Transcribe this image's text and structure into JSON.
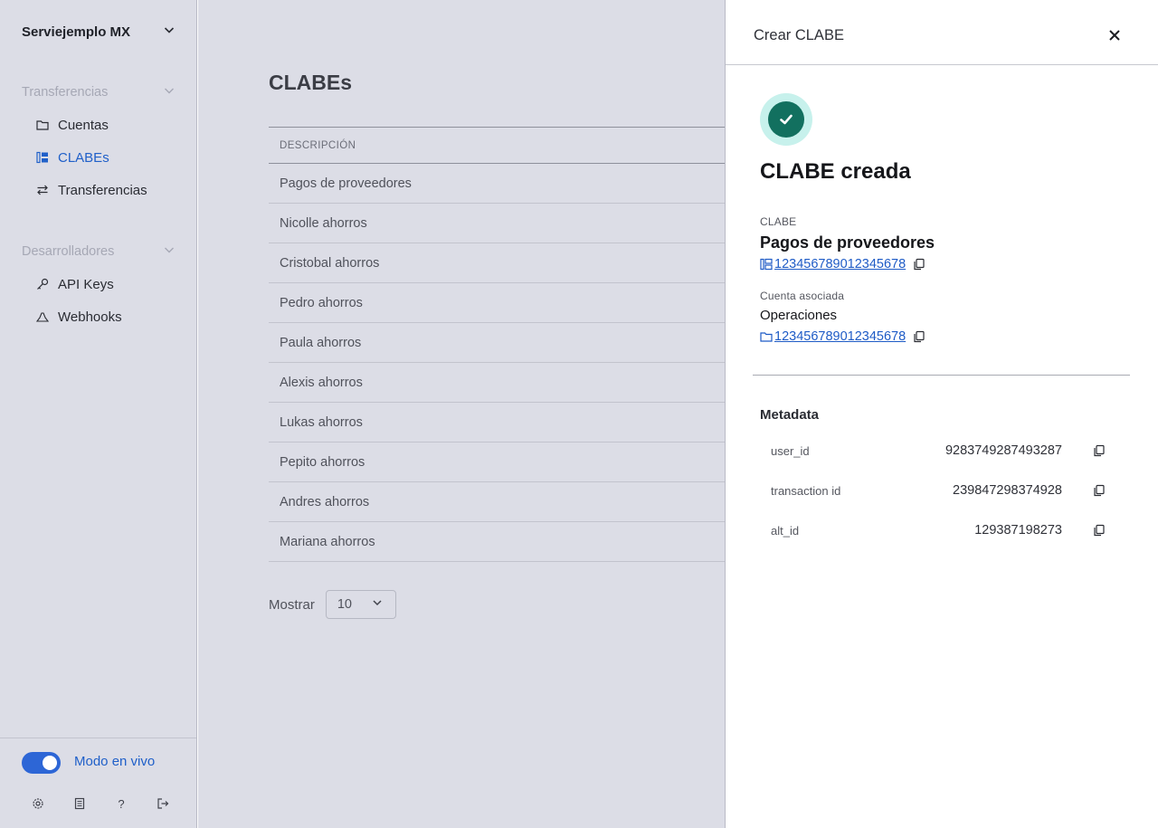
{
  "sidebar": {
    "org_name": "Serviejemplo MX",
    "sections": [
      {
        "title": "Transferencias",
        "items": [
          {
            "label": "Cuentas",
            "icon": "folder-icon"
          },
          {
            "label": "CLABEs",
            "icon": "clabe-icon",
            "active": true
          },
          {
            "label": "Transferencias",
            "icon": "transfer-icon"
          }
        ]
      },
      {
        "title": "Desarrolladores",
        "items": [
          {
            "label": "API Keys",
            "icon": "key-icon"
          },
          {
            "label": "Webhooks",
            "icon": "webhook-icon"
          }
        ]
      }
    ],
    "live_mode_label": "Modo en vivo",
    "live_mode_on": true,
    "footer_icons": [
      "gear-icon",
      "document-icon",
      "help-icon",
      "logout-icon"
    ]
  },
  "main": {
    "title": "CLABEs",
    "table": {
      "header": "DESCRIPCIÓN",
      "rows": [
        "Pagos de proveedores",
        "Nicolle ahorros",
        "Cristobal ahorros",
        "Pedro ahorros",
        "Paula ahorros",
        "Alexis ahorros",
        "Lukas ahorros",
        "Pepito ahorros",
        "Andres ahorros",
        "Mariana ahorros"
      ]
    },
    "pager": {
      "label": "Mostrar",
      "value": "10"
    }
  },
  "drawer": {
    "title": "Crear CLABE",
    "success_title": "CLABE creada",
    "clabe_label": "CLABE",
    "clabe_name": "Pagos de proveedores",
    "clabe_number": "123456789012345678",
    "account_label": "Cuenta asociada",
    "account_name": "Operaciones",
    "account_number": "123456789012345678",
    "metadata_title": "Metadata",
    "metadata": [
      {
        "key": "user_id",
        "value": "9283749287493287"
      },
      {
        "key": "transaction id",
        "value": "239847298374928"
      },
      {
        "key": "alt_id",
        "value": "129387198273"
      }
    ]
  },
  "colors": {
    "accent": "#2060c9",
    "success": "#12705f",
    "success_ring": "#c7f1ec",
    "overlay_bg": "#dcdde6"
  }
}
